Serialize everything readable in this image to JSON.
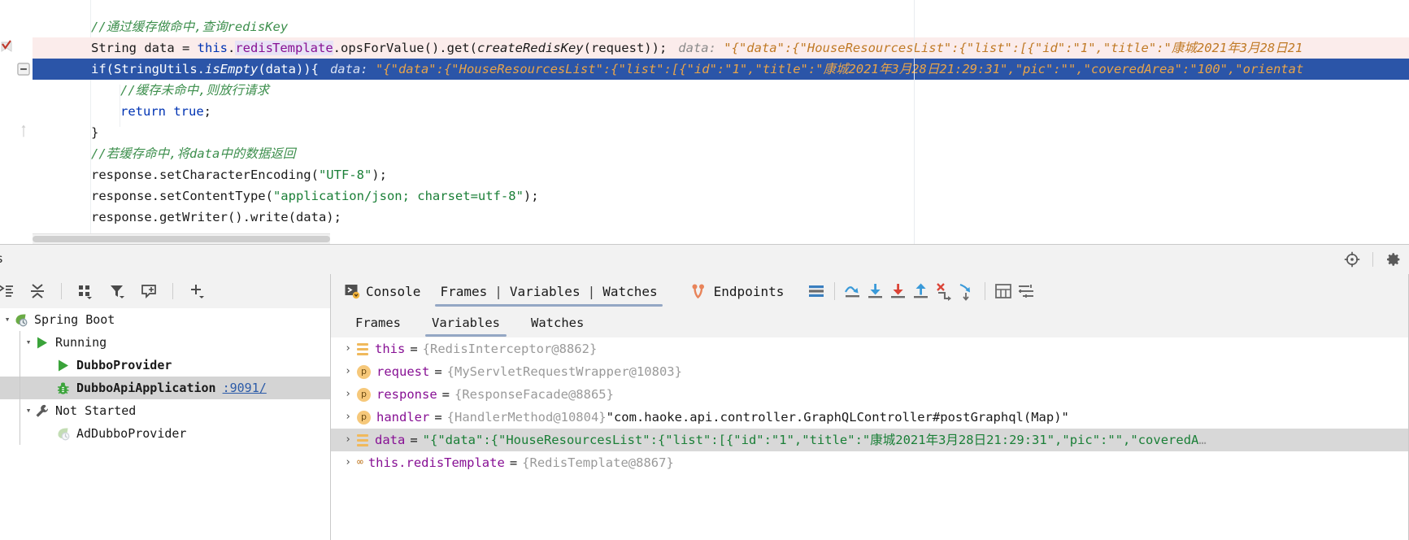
{
  "editor": {
    "lines": [
      {
        "id": "line-comment-1",
        "indent": 0,
        "state": "normal",
        "tokens": [
          {
            "t": "comment",
            "v": "//通过缓存做命中,查询redisKey"
          }
        ]
      },
      {
        "id": "line-string-data",
        "indent": 0,
        "state": "execution-point",
        "tokens": [
          {
            "t": "plain",
            "v": "String data = "
          },
          {
            "t": "keyword",
            "v": "this"
          },
          {
            "t": "plain",
            "v": "."
          },
          {
            "t": "field-hl",
            "v": "redis"
          },
          {
            "t": "caret",
            "v": ""
          },
          {
            "t": "field-hl",
            "v": "Template"
          },
          {
            "t": "plain",
            "v": ".opsForValue().get("
          },
          {
            "t": "method-italic",
            "v": "createRedisKey"
          },
          {
            "t": "plain",
            "v": "(request));"
          }
        ],
        "inline_hint_label": "data:",
        "inline_hint_value": "\"{\"data\":{\"HouseResourcesList\":{\"list\":[{\"id\":\"1\",\"title\":\"康城2021年3月28日21"
      },
      {
        "id": "line-if-isempty",
        "indent": 0,
        "state": "selected",
        "tokens": [
          {
            "t": "plain",
            "v": "if(StringUtils."
          },
          {
            "t": "method-italic",
            "v": "isEmpty"
          },
          {
            "t": "plain",
            "v": "(data)){"
          }
        ],
        "inline_hint_label": "data:",
        "inline_hint_value": "\"{\"data\":{\"HouseResourcesList\":{\"list\":[{\"id\":\"1\",\"title\":\"康城2021年3月28日21:29:31\",\"pic\":\"\",\"coveredArea\":\"100\",\"orientat"
      },
      {
        "id": "line-comment-2",
        "indent": 1,
        "state": "normal",
        "tokens": [
          {
            "t": "comment",
            "v": "//缓存未命中,则放行请求"
          }
        ]
      },
      {
        "id": "line-return-true",
        "indent": 1,
        "state": "normal",
        "tokens": [
          {
            "t": "keyword",
            "v": "return true"
          },
          {
            "t": "plain",
            "v": ";"
          }
        ]
      },
      {
        "id": "line-close-brace",
        "indent": 0,
        "state": "normal",
        "tokens": [
          {
            "t": "plain",
            "v": "}"
          }
        ]
      },
      {
        "id": "line-comment-3",
        "indent": 0,
        "state": "normal",
        "tokens": [
          {
            "t": "comment",
            "v": "//若缓存命中,将data中的数据返回"
          }
        ]
      },
      {
        "id": "line-set-char-encoding",
        "indent": 0,
        "state": "normal",
        "tokens": [
          {
            "t": "plain",
            "v": "response.setCharacterEncoding("
          },
          {
            "t": "string",
            "v": "\"UTF-8\""
          },
          {
            "t": "plain",
            "v": ");"
          }
        ]
      },
      {
        "id": "line-set-content-type",
        "indent": 0,
        "state": "normal",
        "tokens": [
          {
            "t": "plain",
            "v": "response.setContentType("
          },
          {
            "t": "string",
            "v": "\"application/json; charset=utf-8\""
          },
          {
            "t": "plain",
            "v": ");"
          }
        ]
      },
      {
        "id": "line-get-writer-write",
        "indent": 0,
        "state": "normal",
        "tokens": [
          {
            "t": "plain",
            "v": "response.getWriter().write(data);"
          }
        ]
      }
    ]
  },
  "toolwindow": {
    "title": "ces",
    "header_icons": [
      {
        "name": "locate-target-icon",
        "glyph": "target"
      },
      {
        "name": "settings-gear-icon",
        "glyph": "gear"
      }
    ]
  },
  "services_toolbar": [
    {
      "name": "expand-all-icon",
      "glyph": "expand-all"
    },
    {
      "name": "collapse-all-icon",
      "glyph": "collapse-all"
    },
    {
      "name": "group-by-icon",
      "glyph": "group-by"
    },
    {
      "name": "filter-icon",
      "glyph": "filter"
    },
    {
      "name": "add-frame-icon",
      "glyph": "add-frame"
    },
    {
      "name": "add-icon",
      "glyph": "plus"
    }
  ],
  "services_tree": [
    {
      "id": "node-spring-boot",
      "label": "Spring Boot",
      "depth": 0,
      "arrow": "▾",
      "icon": "spring-leaf",
      "bold": false,
      "selected": false,
      "port": ""
    },
    {
      "id": "node-running",
      "label": "Running",
      "depth": 1,
      "arrow": "▾",
      "icon": "run-green",
      "bold": false,
      "selected": false,
      "port": ""
    },
    {
      "id": "node-dubbo-provider",
      "label": "DubboProvider",
      "depth": 2,
      "arrow": "",
      "icon": "run-green",
      "bold": true,
      "selected": false,
      "port": ""
    },
    {
      "id": "node-dubbo-api-app",
      "label": "DubboApiApplication",
      "depth": 2,
      "arrow": "",
      "icon": "debug-bug-green",
      "bold": true,
      "selected": true,
      "port": ":9091/"
    },
    {
      "id": "node-not-started",
      "label": "Not Started",
      "depth": 1,
      "arrow": "▾",
      "icon": "wrench",
      "bold": false,
      "selected": false,
      "port": ""
    },
    {
      "id": "node-ad-dubbo-provider",
      "label": "AdDubboProvider",
      "depth": 2,
      "arrow": "",
      "icon": "spring-leaf-faded",
      "bold": false,
      "selected": false,
      "port": ""
    }
  ],
  "debugger": {
    "tabs": [
      {
        "id": "tab-console",
        "label": "Console",
        "icon": "console-icon",
        "active": false
      },
      {
        "id": "tab-frames",
        "label": "Frames",
        "icon": "",
        "active": true
      },
      {
        "id": "tab-variables",
        "label": "Variables",
        "icon": "",
        "active": true
      },
      {
        "id": "tab-watches",
        "label": "Watches",
        "icon": "",
        "active": true
      },
      {
        "id": "tab-endpoints",
        "label": "Endpoints",
        "icon": "endpoints-icon",
        "active": false
      }
    ],
    "tab_divider": "|",
    "toolbar_icons": [
      {
        "name": "layout-settings-icon",
        "glyph": "layout"
      },
      {
        "name": "step-over-icon",
        "glyph": "step-over"
      },
      {
        "name": "step-into-icon",
        "glyph": "step-into"
      },
      {
        "name": "force-step-into-icon",
        "glyph": "force-step-into"
      },
      {
        "name": "step-out-icon",
        "glyph": "step-out"
      },
      {
        "name": "drop-frame-icon",
        "glyph": "drop-frame"
      },
      {
        "name": "run-to-cursor-icon",
        "glyph": "run-to-cursor"
      },
      {
        "name": "evaluate-expression-icon",
        "glyph": "evaluate"
      },
      {
        "name": "settings-list-icon",
        "glyph": "settings-list"
      }
    ],
    "sub_tabs": [
      {
        "id": "subtab-frames",
        "label": "Frames",
        "active": false
      },
      {
        "id": "subtab-variables",
        "label": "Variables",
        "active": true
      },
      {
        "id": "subtab-watches",
        "label": "Watches",
        "active": false
      }
    ],
    "variables": [
      {
        "id": "var-this",
        "badge": "list",
        "name": "this",
        "type": "{RedisInterceptor@8862}",
        "string": "",
        "selected": false,
        "truncated": false
      },
      {
        "id": "var-request",
        "badge": "p",
        "name": "request",
        "type": "{MyServletRequestWrapper@10803}",
        "string": "",
        "selected": false,
        "truncated": false
      },
      {
        "id": "var-response",
        "badge": "p",
        "name": "response",
        "type": "{ResponseFacade@8865}",
        "string": "",
        "selected": false,
        "truncated": false
      },
      {
        "id": "var-handler",
        "badge": "p",
        "name": "handler",
        "type": "{HandlerMethod@10804}",
        "string": "\"com.haoke.api.controller.GraphQLController#postGraphql(Map)\"",
        "selected": false,
        "truncated": false
      },
      {
        "id": "var-data",
        "badge": "list",
        "name": "data",
        "type": "",
        "string": "\"{\"data\":{\"HouseResourcesList\":{\"list\":[{\"id\":\"1\",\"title\":\"康城2021年3月28日21:29:31\",\"pic\":\"\",\"coveredA",
        "selected": true,
        "truncated": true
      },
      {
        "id": "var-redis-tpl",
        "badge": "oo",
        "name": "this.redisTemplate",
        "type": "{RedisTemplate@8867}",
        "string": "",
        "selected": false,
        "truncated": false
      }
    ]
  },
  "colors": {
    "selection_blue": "#2b55a8",
    "execution_pink": "#fbeceb",
    "tree_selection": "#d4d4d4",
    "row_selection": "#d8d8d8",
    "keyword": "#0033b3",
    "string": "#1a7f37",
    "comment": "#3d8f4d",
    "field": "#871094",
    "inline_hint": "#c07a26",
    "link": "#2b5ba8",
    "toolbar_bg": "#f2f2f2"
  }
}
